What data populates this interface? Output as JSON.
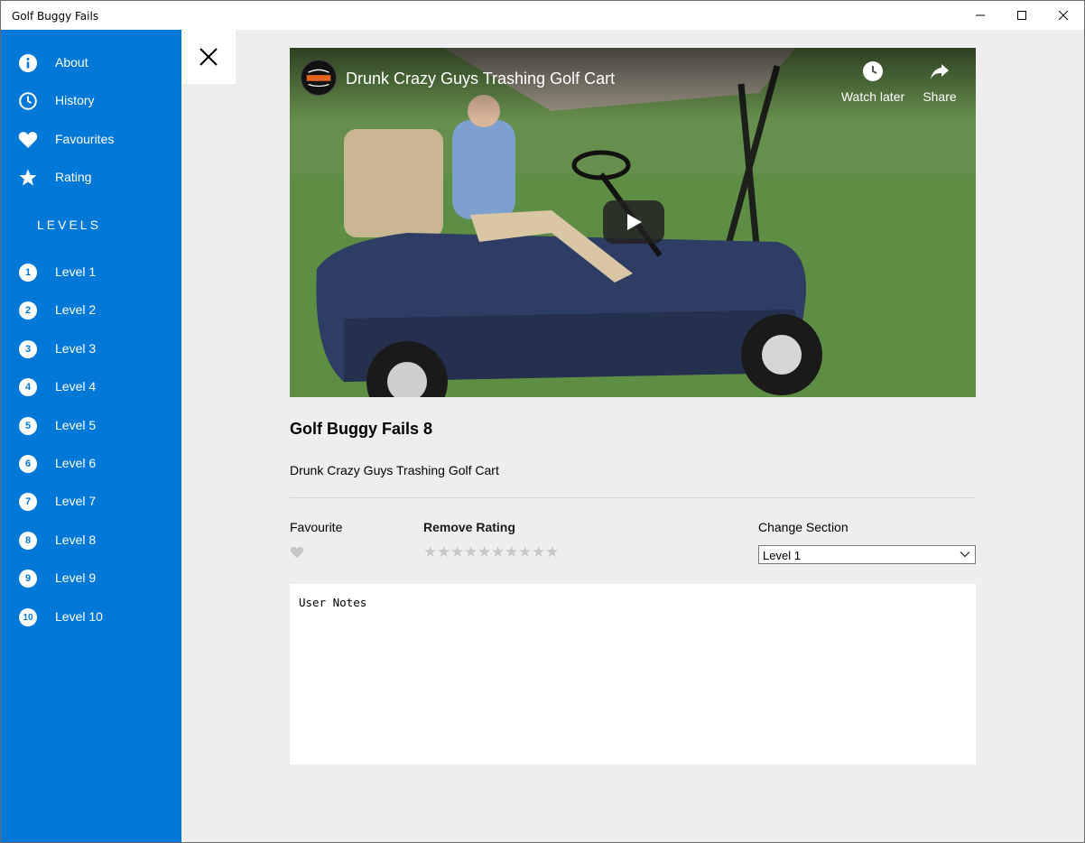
{
  "window": {
    "title": "Golf Buggy Fails"
  },
  "sidebar": {
    "items": [
      {
        "label": "About",
        "icon": "info-icon"
      },
      {
        "label": "History",
        "icon": "clock-icon"
      },
      {
        "label": "Favourites",
        "icon": "heart-icon"
      },
      {
        "label": "Rating",
        "icon": "star-icon"
      }
    ],
    "levels_heading": "LEVELS",
    "levels": [
      {
        "num": "1",
        "label": "Level 1"
      },
      {
        "num": "2",
        "label": "Level 2"
      },
      {
        "num": "3",
        "label": "Level 3"
      },
      {
        "num": "4",
        "label": "Level 4"
      },
      {
        "num": "5",
        "label": "Level 5"
      },
      {
        "num": "6",
        "label": "Level 6"
      },
      {
        "num": "7",
        "label": "Level 7"
      },
      {
        "num": "8",
        "label": "Level 8"
      },
      {
        "num": "9",
        "label": "Level 9"
      },
      {
        "num": "10",
        "label": "Level 10"
      }
    ]
  },
  "video": {
    "title": "Drunk Crazy Guys Trashing Golf Cart",
    "watch_later": "Watch later",
    "share": "Share"
  },
  "detail": {
    "heading": "Golf Buggy Fails 8",
    "description": "Drunk Crazy Guys Trashing Golf Cart",
    "favourite_label": "Favourite",
    "remove_rating_label": "Remove Rating",
    "change_section_label": "Change Section",
    "section_selected": "Level 1",
    "rating": {
      "value": 0,
      "max": 10
    },
    "user_notes_placeholder": "User Notes"
  },
  "colors": {
    "sidebar": "#0078d7",
    "background": "#eeeeee",
    "star_inactive": "#c8c8c8"
  }
}
